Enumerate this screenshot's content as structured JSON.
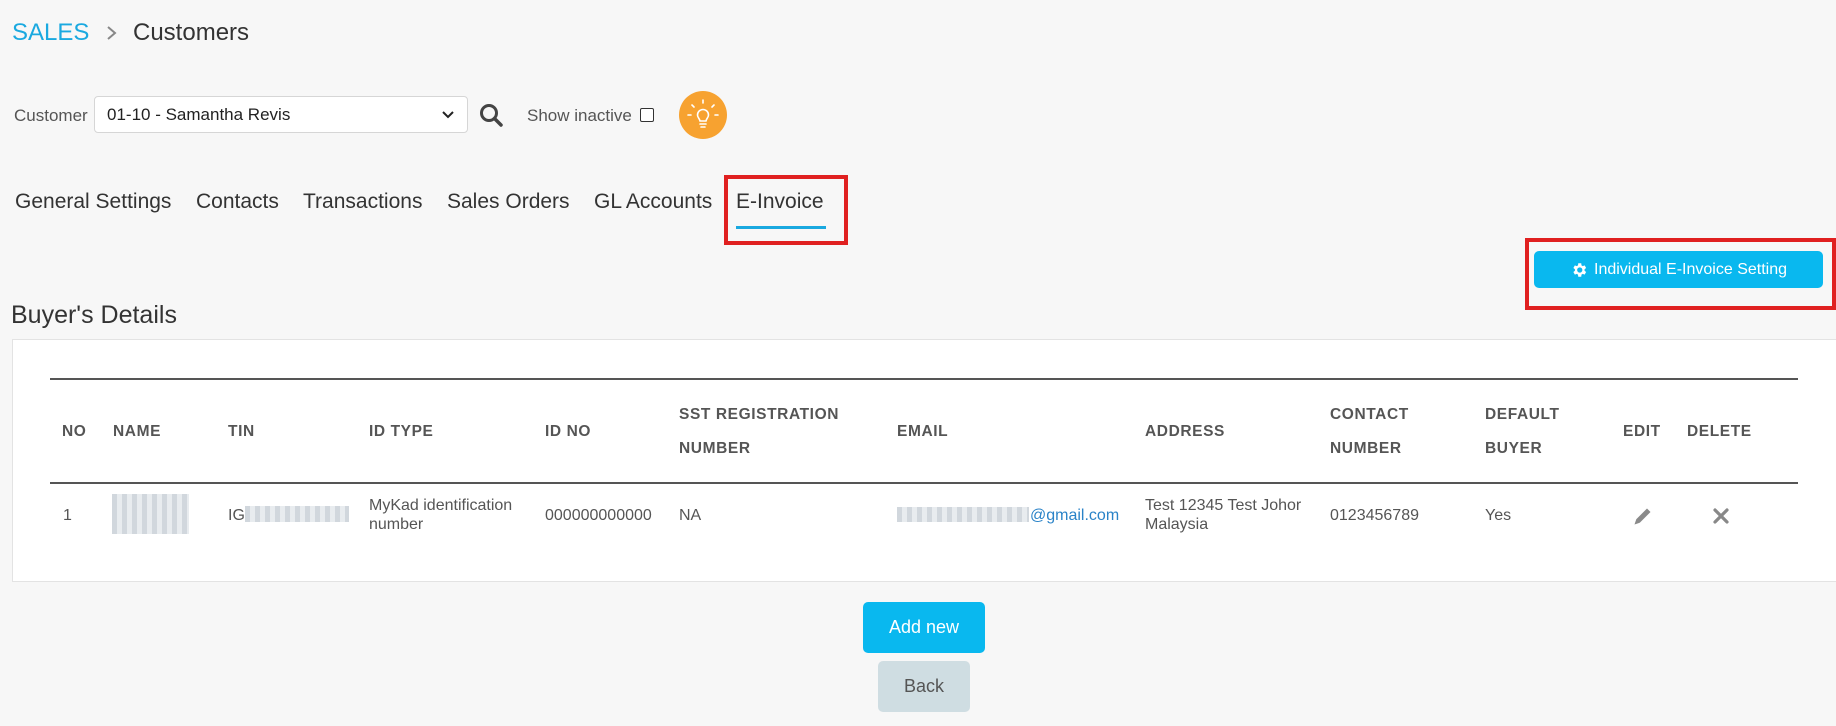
{
  "breadcrumb": {
    "root": "SALES",
    "current": "Customers"
  },
  "filter": {
    "customer_label": "Customer",
    "customer_value": "01-10 - Samantha Revis",
    "show_inactive_label": "Show inactive",
    "show_inactive_checked": false
  },
  "tabs": [
    {
      "label": "General Settings"
    },
    {
      "label": "Contacts"
    },
    {
      "label": "Transactions"
    },
    {
      "label": "Sales Orders"
    },
    {
      "label": "GL Accounts"
    },
    {
      "label": "E-Invoice"
    }
  ],
  "active_tab": "E-Invoice",
  "setting_button": {
    "label": "Individual E-Invoice Setting"
  },
  "section_title": "Buyer's Details",
  "table": {
    "headers": {
      "no": "NO",
      "name": "NAME",
      "tin": "TIN",
      "id_type": "ID TYPE",
      "id_no": "ID NO",
      "sst_1": "SST REGISTRATION",
      "sst_2": "NUMBER",
      "email": "EMAIL",
      "address": "ADDRESS",
      "contact_1": "CONTACT",
      "contact_2": "NUMBER",
      "default_1": "DEFAULT",
      "default_2": "BUYER",
      "edit": "EDIT",
      "delete": "DELETE"
    },
    "rows": [
      {
        "no": "1",
        "tin_prefix": "IG",
        "id_type_1": "MyKad identification",
        "id_type_2": "number",
        "id_no": "000000000000",
        "sst": "NA",
        "email_suffix": "@gmail.com",
        "address_1": "Test 12345 Test Johor",
        "address_2": "Malaysia",
        "contact": "0123456789",
        "default_buyer": "Yes"
      }
    ]
  },
  "buttons": {
    "add_new": "Add new",
    "back": "Back"
  },
  "colors": {
    "accent": "#09b8ef",
    "link": "#1aa9e0",
    "highlight": "#e02020",
    "bulb": "#f7a230"
  }
}
